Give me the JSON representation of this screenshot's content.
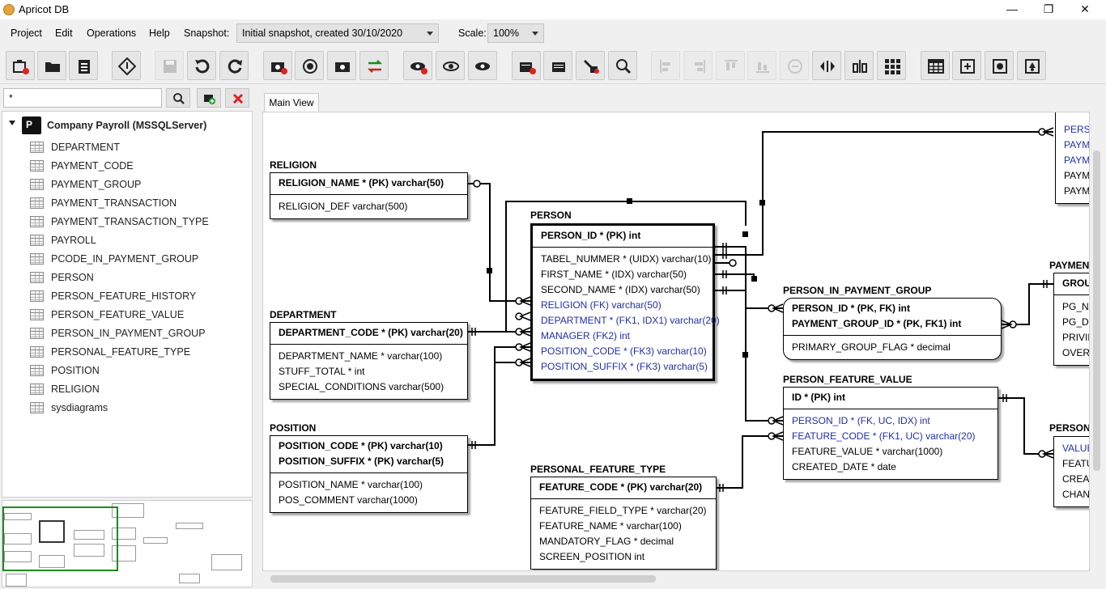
{
  "window": {
    "title": "Apricot DB",
    "minimize": "—",
    "maximize": "❐",
    "close": "✕"
  },
  "menu": {
    "items": [
      "Project",
      "Edit",
      "Operations",
      "Help"
    ],
    "snapshot_label": "Snapshot:",
    "snapshot_value": "Initial snapshot, created 30/10/2020",
    "scale_label": "Scale:",
    "scale_value": "100%"
  },
  "left": {
    "search_value": "*",
    "root": "Company Payroll (MSSQLServer)",
    "root_icon_text": "P",
    "tables": [
      "DEPARTMENT",
      "PAYMENT_CODE",
      "PAYMENT_GROUP",
      "PAYMENT_TRANSACTION",
      "PAYMENT_TRANSACTION_TYPE",
      "PAYROLL",
      "PCODE_IN_PAYMENT_GROUP",
      "PERSON",
      "PERSON_FEATURE_HISTORY",
      "PERSON_FEATURE_VALUE",
      "PERSON_IN_PAYMENT_GROUP",
      "PERSONAL_FEATURE_TYPE",
      "POSITION",
      "RELIGION",
      "sysdiagrams"
    ]
  },
  "tabs": {
    "main": "Main View"
  },
  "entities": {
    "religion": {
      "name": "RELIGION",
      "pk": [
        "RELIGION_NAME * (PK) varchar(50)"
      ],
      "cols": [
        {
          "t": "RELIGION_DEF varchar(500)",
          "fk": false
        }
      ]
    },
    "department": {
      "name": "DEPARTMENT",
      "pk": [
        "DEPARTMENT_CODE * (PK) varchar(20)"
      ],
      "cols": [
        {
          "t": "DEPARTMENT_NAME * varchar(100)",
          "fk": false
        },
        {
          "t": "STUFF_TOTAL * int",
          "fk": false
        },
        {
          "t": "SPECIAL_CONDITIONS varchar(500)",
          "fk": false
        }
      ]
    },
    "position": {
      "name": "POSITION",
      "pk": [
        "POSITION_CODE * (PK) varchar(10)",
        "POSITION_SUFFIX * (PK) varchar(5)"
      ],
      "cols": [
        {
          "t": "POSITION_NAME * varchar(100)",
          "fk": false
        },
        {
          "t": "POS_COMMENT varchar(1000)",
          "fk": false
        }
      ]
    },
    "person": {
      "name": "PERSON",
      "pk": [
        "PERSON_ID * (PK) int"
      ],
      "cols": [
        {
          "t": "TABEL_NUMMER * (UIDX) varchar(10)",
          "fk": false
        },
        {
          "t": "FIRST_NAME * (IDX) varchar(50)",
          "fk": false
        },
        {
          "t": "SECOND_NAME * (IDX) varchar(50)",
          "fk": false
        },
        {
          "t": "RELIGION (FK) varchar(50)",
          "fk": true
        },
        {
          "t": "DEPARTMENT * (FK1, IDX1) varchar(20)",
          "fk": true
        },
        {
          "t": "MANAGER (FK2) int",
          "fk": true
        },
        {
          "t": "POSITION_CODE * (FK3) varchar(10)",
          "fk": true
        },
        {
          "t": "POSITION_SUFFIX * (FK3) varchar(5)",
          "fk": true
        }
      ]
    },
    "personal_feature_type": {
      "name": "PERSONAL_FEATURE_TYPE",
      "pk": [
        "FEATURE_CODE * (PK) varchar(20)"
      ],
      "cols": [
        {
          "t": "FEATURE_FIELD_TYPE * varchar(20)",
          "fk": false
        },
        {
          "t": "FEATURE_NAME * varchar(100)",
          "fk": false
        },
        {
          "t": "MANDATORY_FLAG * decimal",
          "fk": false
        },
        {
          "t": "SCREEN_POSITION int",
          "fk": false
        }
      ]
    },
    "person_in_payment_group": {
      "name": "PERSON_IN_PAYMENT_GROUP",
      "pk": [
        "PERSON_ID * (PK, FK) int",
        "PAYMENT_GROUP_ID * (PK, FK1) int"
      ],
      "cols": [
        {
          "t": "PRIMARY_GROUP_FLAG * decimal",
          "fk": false
        }
      ]
    },
    "person_feature_value": {
      "name": "PERSON_FEATURE_VALUE",
      "pk": [
        "ID * (PK) int"
      ],
      "cols": [
        {
          "t": "PERSON_ID * (FK, UC, IDX) int",
          "fk": true
        },
        {
          "t": "FEATURE_CODE * (FK1, UC) varchar(20)",
          "fk": true
        },
        {
          "t": "FEATURE_VALUE * varchar(1000)",
          "fk": false
        },
        {
          "t": "CREATED_DATE * date",
          "fk": false
        }
      ]
    },
    "payment_group_partial": {
      "name": "PAYMEN",
      "pk": [
        "GROUP"
      ],
      "cols": [
        {
          "t": "PG_NAM",
          "fk": false
        },
        {
          "t": "PG_DEF",
          "fk": false
        },
        {
          "t": "PRIVILE",
          "fk": false
        },
        {
          "t": "OVERTI",
          "fk": false
        }
      ]
    },
    "top_right_partial": {
      "cols": [
        {
          "t": "PERSO",
          "fk": true
        },
        {
          "t": "PAYM",
          "fk": true
        },
        {
          "t": "PAYM",
          "fk": true
        },
        {
          "t": "PAYM",
          "fk": false
        },
        {
          "t": "PAYM",
          "fk": false
        }
      ]
    },
    "person_feature_history_partial": {
      "name": "PERSON_",
      "cols": [
        {
          "t": "VALUE_",
          "fk": true
        },
        {
          "t": "FEATUR",
          "fk": false
        },
        {
          "t": "CREATE",
          "fk": false
        },
        {
          "t": "CHANG",
          "fk": false
        }
      ]
    }
  }
}
